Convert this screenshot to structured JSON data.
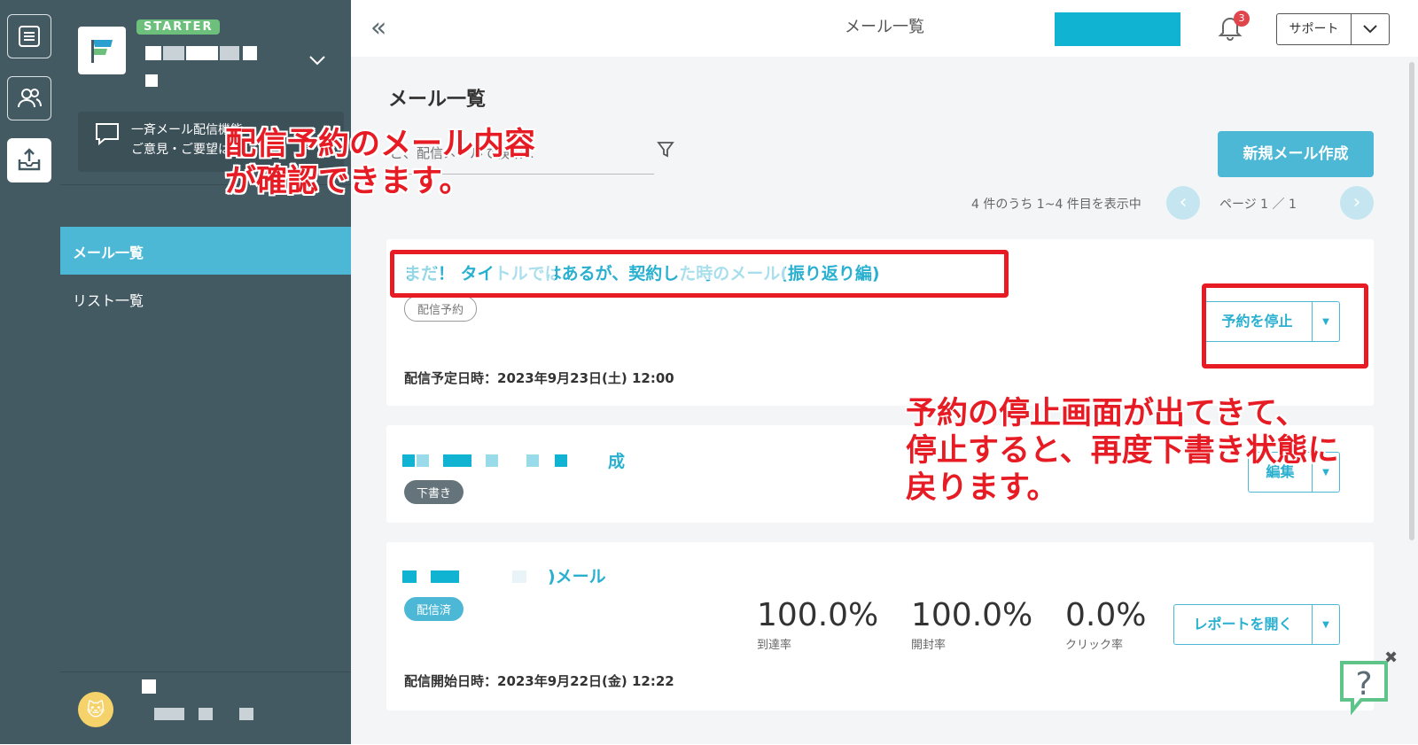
{
  "topbar": {
    "title": "メール一覧",
    "notification_count": "3",
    "support_label": "サポート"
  },
  "sidebar": {
    "plan_badge": "STARTER",
    "feedback": {
      "line1": "一斉メール配信機能",
      "line2": "ご意見・ご要望は"
    },
    "nav": [
      {
        "label": "メール一覧",
        "active": true
      },
      {
        "label": "リスト一覧",
        "active": false
      }
    ]
  },
  "main": {
    "heading": "メール一覧",
    "search_placeholder": "ご、配信メールで検索...",
    "new_mail_button": "新規メール作成",
    "count_text": "4 件のうち 1~4 件目を表示中",
    "page_text": "ページ 1 ／ 1",
    "cards": [
      {
        "title": "まだ！ タイトルではあるが、契約した時のメール(振り返り編)",
        "badge": "配信予約",
        "date": "配信予定日時：2023年9月23日(土) 12:00",
        "action": "予約を停止"
      },
      {
        "title_tail": "成",
        "badge": "下書き",
        "action": "編集"
      },
      {
        "title_tail": ")メール",
        "badge": "配信済",
        "date": "配信開始日時：2023年9月22日(金) 12:22",
        "action": "レポートを開く",
        "stats": [
          {
            "value": "100.0%",
            "label": "到達率"
          },
          {
            "value": "100.0%",
            "label": "開封率"
          },
          {
            "value": "0.0%",
            "label": "クリック率"
          }
        ]
      }
    ]
  },
  "annotations": {
    "note1_line1": "配信予約のメール内容",
    "note1_line2": "が確認できます。",
    "note2_line1": "予約の停止画面が出てきて、",
    "note2_line2": "停止すると、再度下書き状態に",
    "note2_line3": "戻ります。",
    "color": "#e61b23"
  },
  "colors": {
    "sidebar": "#445a62",
    "accent": "#4cb8d6",
    "background": "#f4f5f7"
  }
}
